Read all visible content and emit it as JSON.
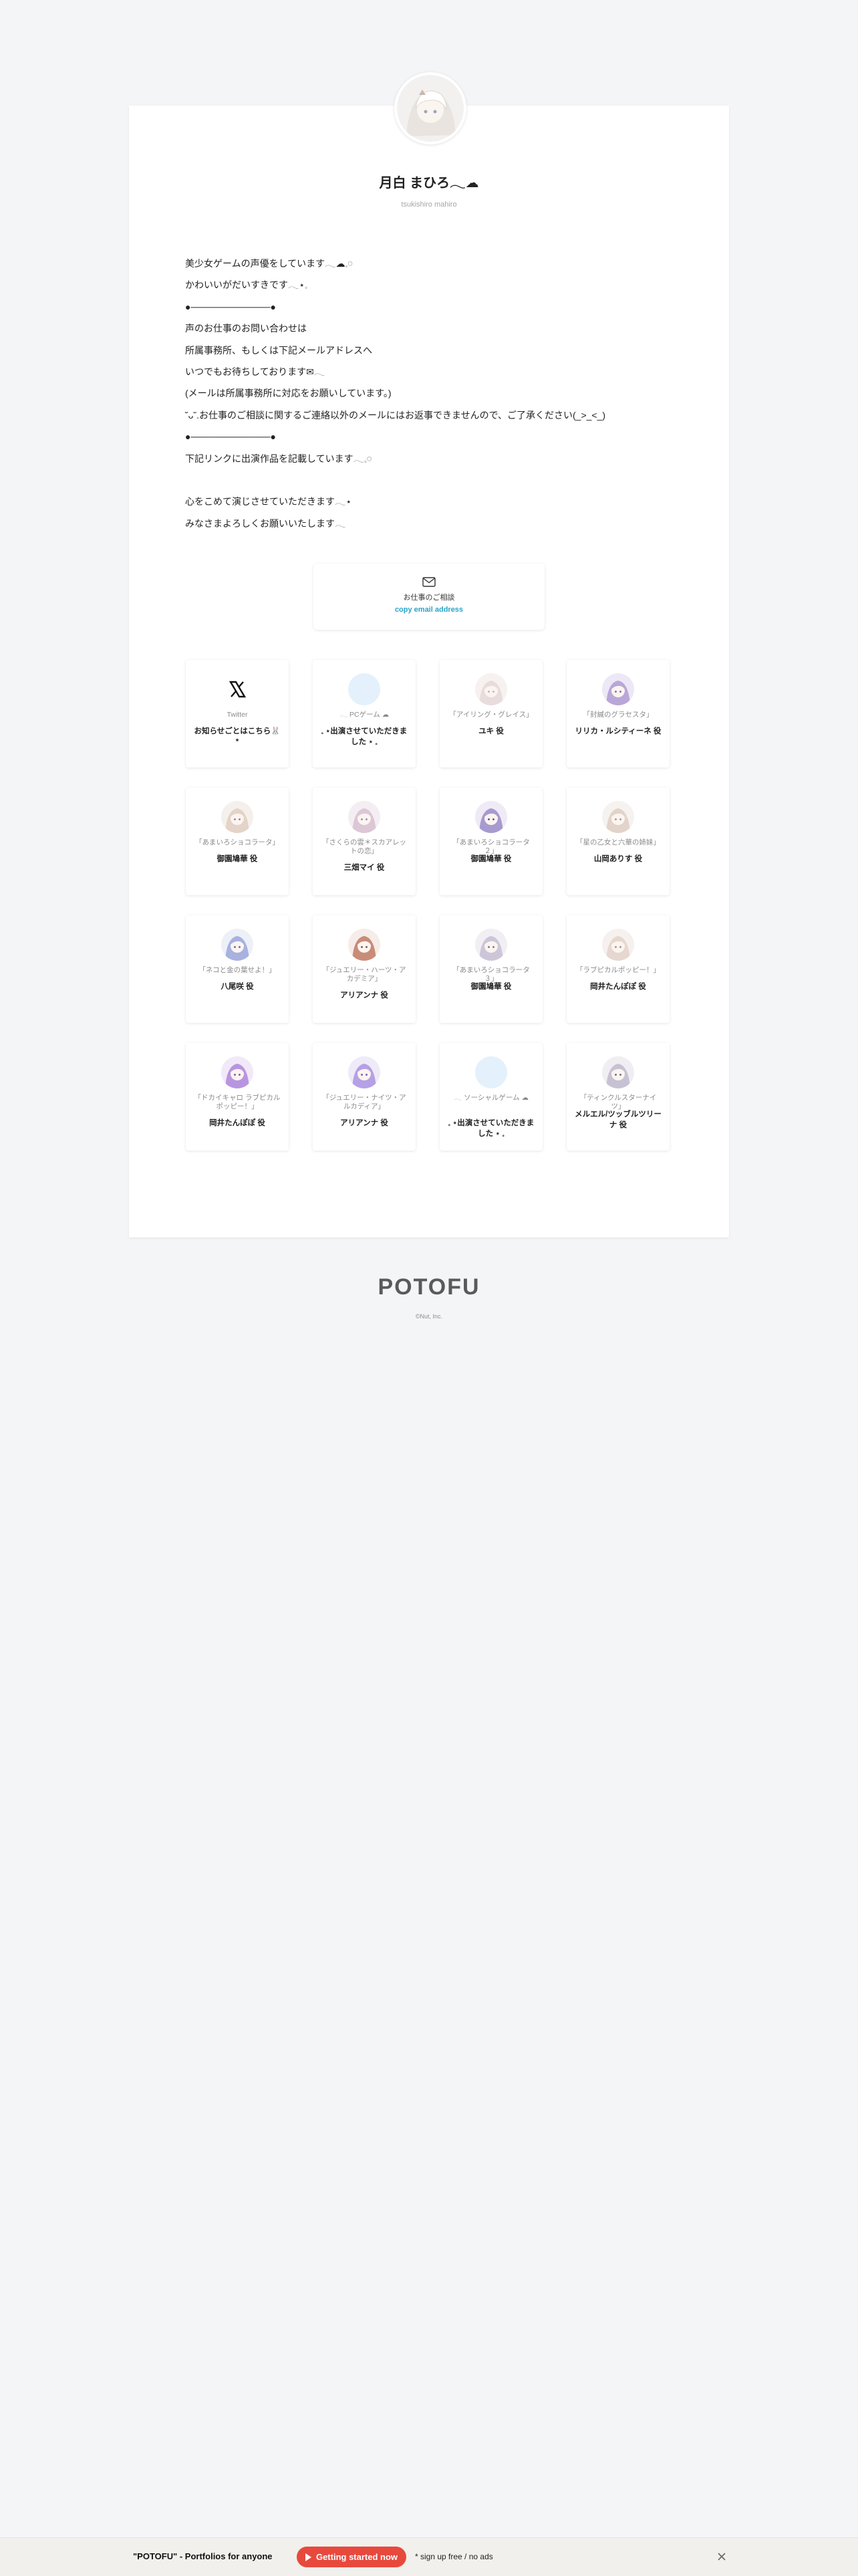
{
  "profile": {
    "name": "月白 まひろ𓂃☁︎",
    "handle": "tsukishiro mahiro"
  },
  "bio_lines": [
    "美少女ゲームの声優をしています𓂃☁︎𓈒𓏸",
    "かわいいがだいすきです𓂃⋆𓈒",
    "●────────────●",
    "声のお仕事のお問い合わせは",
    "所属事務所、もしくは下記メールアドレスへ",
    "いつでもお待ちしております✉︎𓂃",
    "(メールは所属事務所に対応をお願いしています。)",
    "˘ᴗ˘.お仕事のご相談に関するご連絡以外のメールにはお返事できませんので、ご了承ください(_>_<_)",
    "●────────────●",
    "下記リンクに出演作品を記載しています𓂃𓈒𓏸",
    "",
    "心をこめて演じさせていただきます𓂃⋆",
    "みなさまよろしくお願いいたします𓂃"
  ],
  "contact": {
    "icon": "mail-icon",
    "title": "お仕事のご相談",
    "copy_label": "copy email address"
  },
  "links": [
    {
      "title": "Twitter",
      "subtitle": "お知らせごとはこちら🐰*",
      "icon": "x-logo-icon"
    },
    {
      "title": "𓂃 PCゲーム ☁︎",
      "subtitle": "𓈒 ⋆出演させていただきました ⋆ 𓈒",
      "icon": "blank-avatar-icon"
    },
    {
      "title": "「アイリング・グレイス」",
      "subtitle": "ユキ 役",
      "icon": "character-avatar-icon"
    },
    {
      "title": "「封緘のグラセスタ」",
      "subtitle": "リリカ・ルシティーネ 役",
      "icon": "character-avatar-icon"
    },
    {
      "title": "「あまいろショコラータ」",
      "subtitle": "御園鳩華 役",
      "icon": "character-avatar-icon"
    },
    {
      "title": "「さくらの雲＊スカアレットの恋」",
      "subtitle": "三畑マイ 役",
      "icon": "character-avatar-icon"
    },
    {
      "title": "「あまいろショコラータ２」",
      "subtitle": "御園鳩華 役",
      "icon": "character-avatar-icon"
    },
    {
      "title": "「星の乙女と六華の姉妹」",
      "subtitle": "山岡ありす 役",
      "icon": "character-avatar-icon"
    },
    {
      "title": "「ネコと金の葉せよ！」",
      "subtitle": "八尾咲 役",
      "icon": "character-avatar-icon"
    },
    {
      "title": "「ジュエリー・ハーツ・アカデミア」",
      "subtitle": "アリアンナ 役",
      "icon": "character-avatar-icon"
    },
    {
      "title": "「あまいろショコラータ３」",
      "subtitle": "御園鳩華 役",
      "icon": "character-avatar-icon"
    },
    {
      "title": "「ラブピカルポッピー！」",
      "subtitle": "岡井たんぽぽ 役",
      "icon": "character-avatar-icon"
    },
    {
      "title": "「ドカイキャロ ラブピカルポッピー！」",
      "subtitle": "岡井たんぽぽ 役",
      "icon": "character-avatar-icon"
    },
    {
      "title": "「ジュエリー・ナイツ・アルカディア」",
      "subtitle": "アリアンナ 役",
      "icon": "character-avatar-icon"
    },
    {
      "title": "𓂃 ソーシャルゲーム ☁︎",
      "subtitle": "𓈒 ⋆出演させていただきました ⋆ 𓈒",
      "icon": "blank-avatar-icon"
    },
    {
      "title": "「ティンクルスターナイツ」",
      "subtitle": "メルエル/ツッブルツリーナ 役",
      "icon": "character-avatar-icon"
    }
  ],
  "footer": {
    "brand": "POTOFU",
    "copyright": "©Nut, Inc."
  },
  "banner": {
    "lead": "\"POTOFU\" - Portfolios for anyone",
    "cta": "Getting started now",
    "note": "* sign up free / no ads",
    "close_icon": "close-icon"
  },
  "colors": {
    "background": "#f4f5f7",
    "link_blue": "#2aa3c7",
    "cta_red": "#e8493d",
    "banner_bg": "#f1f0ec"
  }
}
